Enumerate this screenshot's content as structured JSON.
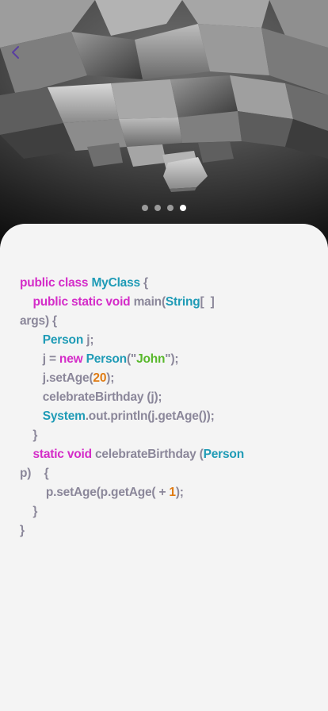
{
  "hero": {
    "image": "abstract-grey-cubes-image",
    "back_icon": "chevron-left-icon",
    "carousel": {
      "count": 4,
      "active_index": 3
    }
  },
  "colors": {
    "keyword": "#d42cc8",
    "type": "#1f9bb6",
    "string": "#58b82b",
    "number": "#e07b12",
    "plain": "#8b879a",
    "back_icon": "#5a3fa0"
  },
  "code": {
    "lines": [
      [
        {
          "t": "kw",
          "v": "public class "
        },
        {
          "t": "ty",
          "v": "MyClass"
        },
        {
          "t": "pl",
          "v": " {"
        }
      ],
      [
        {
          "t": "pl",
          "v": "    "
        },
        {
          "t": "kw",
          "v": "public static void "
        },
        {
          "t": "pl",
          "v": "main("
        },
        {
          "t": "ty",
          "v": "String"
        },
        {
          "t": "pl",
          "v": "[  ]"
        }
      ],
      [
        {
          "t": "pl",
          "v": "args) {"
        }
      ],
      [
        {
          "t": "pl",
          "v": "       "
        },
        {
          "t": "ty",
          "v": "Person"
        },
        {
          "t": "pl",
          "v": " j;"
        }
      ],
      [
        {
          "t": "pl",
          "v": "       j = "
        },
        {
          "t": "kw",
          "v": "new "
        },
        {
          "t": "ty",
          "v": "Person"
        },
        {
          "t": "pl",
          "v": "(\""
        },
        {
          "t": "str",
          "v": "John"
        },
        {
          "t": "pl",
          "v": "\");"
        }
      ],
      [
        {
          "t": "pl",
          "v": "       j.setAge("
        },
        {
          "t": "num",
          "v": "20"
        },
        {
          "t": "pl",
          "v": ");"
        }
      ],
      [
        {
          "t": "pl",
          "v": "       celebrateBirthday (j);"
        }
      ],
      [
        {
          "t": "pl",
          "v": "       "
        },
        {
          "t": "ty",
          "v": "System"
        },
        {
          "t": "pl",
          "v": ".out.println(j.getAge());"
        }
      ],
      [
        {
          "t": "pl",
          "v": "    }"
        }
      ],
      [
        {
          "t": "pl",
          "v": "    "
        },
        {
          "t": "kw",
          "v": "static void "
        },
        {
          "t": "pl",
          "v": "celebrateBirthday ("
        },
        {
          "t": "ty",
          "v": "Person"
        }
      ],
      [
        {
          "t": "pl",
          "v": "p)    {"
        }
      ],
      [
        {
          "t": "pl",
          "v": "        p.setAge(p.getAge( + "
        },
        {
          "t": "num",
          "v": "1"
        },
        {
          "t": "pl",
          "v": ");"
        }
      ],
      [
        {
          "t": "pl",
          "v": "    }"
        }
      ],
      [
        {
          "t": "pl",
          "v": "}"
        }
      ]
    ]
  }
}
